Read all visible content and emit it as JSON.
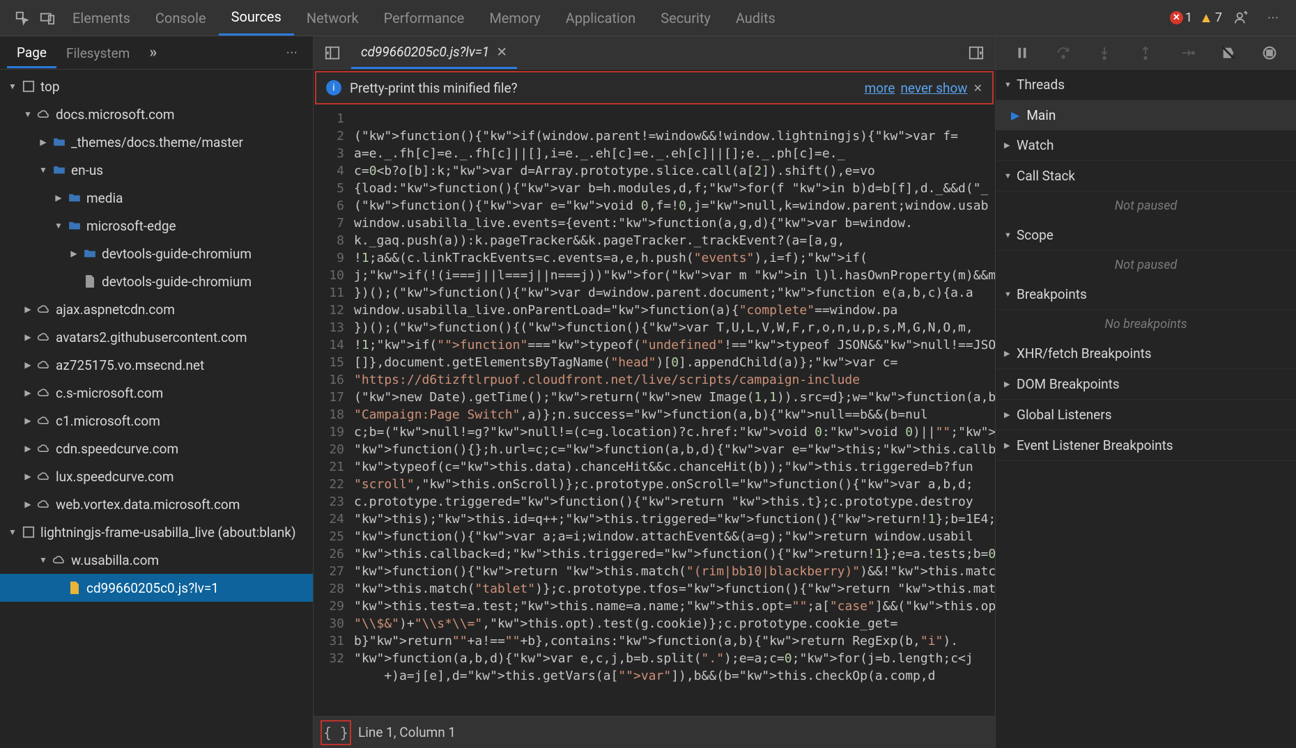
{
  "top_tabs": {
    "elements": "Elements",
    "console": "Console",
    "sources": "Sources",
    "network": "Network",
    "performance": "Performance",
    "memory": "Memory",
    "application": "Application",
    "security": "Security",
    "audits": "Audits"
  },
  "status": {
    "errors": "1",
    "warnings": "7"
  },
  "nav": {
    "page": "Page",
    "filesystem": "Filesystem",
    "more": "»",
    "dots": "⋯"
  },
  "tree": {
    "top": "top",
    "docs": "docs.microsoft.com",
    "themes": "_themes/docs.theme/master",
    "enus": "en-us",
    "media": "media",
    "msedge": "microsoft-edge",
    "guide_folder": "devtools-guide-chromium",
    "guide_file": "devtools-guide-chromium",
    "ajax": "ajax.aspnetcdn.com",
    "avatars": "avatars2.githubusercontent.com",
    "az": "az725175.vo.msecnd.net",
    "csms": "c.s-microsoft.com",
    "c1ms": "c1.microsoft.com",
    "cdnsc": "cdn.speedcurve.com",
    "luxsc": "lux.speedcurve.com",
    "vortex": "web.vortex.data.microsoft.com",
    "lightning": "lightningjs-frame-usabilla_live (about:blank)",
    "wusabilla": "w.usabilla.com",
    "jsfile": "cd99660205c0.js?lv=1"
  },
  "tab": {
    "filename": "cd99660205c0.js?lv=1"
  },
  "pretty": {
    "text": "Pretty-print this minified file?",
    "more": "more",
    "never": "never show"
  },
  "code": {
    "l1": "(function(){if(window.parent!=window&&!window.lightningjs){var f=",
    "l2": "a=e._.fh[c]=e._.fh[c]||[],i=e._.eh[c]=e._.eh[c]||[];e._.ph[c]=e._",
    "l3": "c=0<b?o[b]:k;var d=Array.prototype.slice.call(a[2]).shift(),e=vo",
    "l4": "{load:function(){var b=h.modules,d,f;for(f in b)d=b[f],d._&&d(\"_",
    "l5": "(function(){var e=void 0,f=!0,j=null,k=window.parent;window.usab",
    "l6": "window.usabilla_live.events={event:function(a,g,d){var b=window.",
    "l7": "k._gaq.push(a)):k.pageTracker&&k.pageTracker._trackEvent?(a=[a,g,",
    "l8": "!1;a&&(c.linkTrackEvents=c.events=a,e,h.push(\"events\"),i=f);if(",
    "l9": "j;if(!(i===j||l===j||n===j))for(var m in l)l.hasOwnProperty(m)&&m",
    "l10": "})();(function(){var d=window.parent.document;function e(a,b,c){a.a",
    "l11": "window.usabilla_live.onParentLoad=function(a){\"complete\"==window.pa",
    "l12": "})();(function(){(function(){var T,U,L,V,W,F,r,o,n,u,p,s,M,G,N,O,m,",
    "l13": "!1;if(\"function\"===typeof(\"undefined\"!==typeof JSON&&null!==JSON?JS",
    "l14": "[]},document.getElementsByTagName(\"head\")[0].appendChild(a)};var c=",
    "l15": "\"https://d6tizftlrpuof.cloudfront.net/live/scripts/campaign-include",
    "l16": "(new Date).getTime();return(new Image(1,1)).src=d};w=function(a,b,c",
    "l17": "\"Campaign:Page Switch\",a)};n.success=function(a,b){null==b&&(b=nul",
    "l18": "c;b=(null!=g?null!=(c=g.location)?c.href:void 0:void 0)||\"\";if(a)re",
    "l19": "function(){};h.url=c;c=function(a,b,d){var e=this;this.callback=d;t",
    "l20": "typeof(c=this.data).chanceHit&&c.chanceHit(b));this.triggered=b?fun",
    "l21": "\"scroll\",this.onScroll)};c.prototype.onScroll=function(){var a,b,d;",
    "l22": "c.prototype.triggered=function(){return this.t};c.prototype.destroy",
    "l23": "this);this.id=q++;this.triggered=function(){return!1};b=1E4;\"time\"i",
    "l24": "function(){var a;a=i;window.attachEvent&&(a=g);return window.usabil",
    "l25": "this.callback=d;this.triggered=function(){return!1};e=a.tests;b=0;f",
    "l26": "function(){return this.match(\"(rim|bb10|blackberry)\")&&!this.match(",
    "l27": "this.match(\"tablet\")};c.prototype.tfos=function(){return this.match",
    "l28": "this.test=a.test;this.name=a.name;this.opt=\"\";a[\"case\"]&&(this.opt=",
    "l29": "\"\\\\$&\")+\"\\\\s*\\\\=\",this.opt).test(g.cookie)};c.prototype.cookie_get=",
    "l30": "b}return\"\"+a!==\"\"+b},contains:function(a,b){return RegExp(b,\"i\").",
    "l31": "function(a,b,d){var e,c,j,b=b.split(\".\");e=a;c=0;for(j=b.length;c<j",
    "l32": "    +)a=j[e],d=this.getVars(a[\"var\"]),b&&(b=this.checkOp(a.comp,d"
  },
  "statusbar": {
    "braces": "{ }",
    "pos": "Line 1, Column 1"
  },
  "debug": {
    "threads": "Threads",
    "main": "Main",
    "watch": "Watch",
    "callstack": "Call Stack",
    "not_paused": "Not paused",
    "scope": "Scope",
    "breakpoints": "Breakpoints",
    "no_bp": "No breakpoints",
    "xhr": "XHR/fetch Breakpoints",
    "dom": "DOM Breakpoints",
    "global": "Global Listeners",
    "event": "Event Listener Breakpoints"
  }
}
